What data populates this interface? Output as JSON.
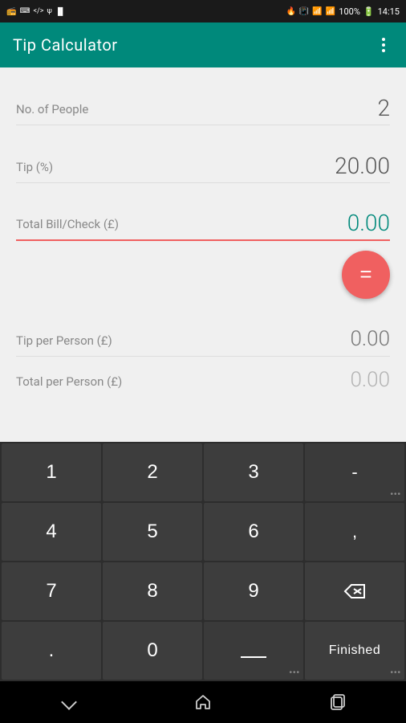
{
  "statusBar": {
    "time": "14:15",
    "battery": "100%",
    "icons": [
      "radio",
      "keyboard",
      "code",
      "usb",
      "barcode"
    ]
  },
  "appBar": {
    "title": "Tip Calculator",
    "overflowMenuLabel": "⋮"
  },
  "form": {
    "noOfPeople": {
      "label": "No. of People",
      "value": "2"
    },
    "tip": {
      "label": "Tip (%)",
      "value": "20.00"
    },
    "totalBill": {
      "label": "Total Bill/Check (£)",
      "value": "0.00"
    }
  },
  "equalsButton": {
    "symbol": "="
  },
  "results": {
    "tipPerPerson": {
      "label": "Tip per Person (£)",
      "value": "0.00"
    },
    "totalPerPerson": {
      "label": "Total per Person (£)",
      "value": "0.00"
    }
  },
  "keyboard": {
    "rows": [
      [
        "1",
        "2",
        "3",
        "-"
      ],
      [
        "4",
        "5",
        "6",
        ","
      ],
      [
        "7",
        "8",
        "9",
        "⌫"
      ],
      [
        ".",
        "0",
        "⎵",
        "Finished"
      ]
    ]
  },
  "navBar": {
    "back": "back",
    "home": "home",
    "recent": "recent"
  }
}
